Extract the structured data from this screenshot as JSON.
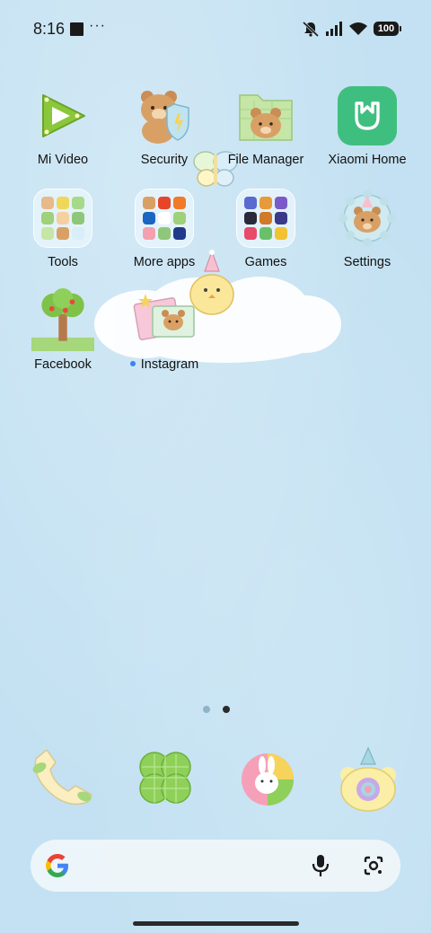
{
  "status_bar": {
    "time": "8:16",
    "overflow_indicator": "···",
    "battery": "100",
    "icons": [
      "silent-mode-icon",
      "signal-icon",
      "wifi-icon",
      "battery-icon"
    ]
  },
  "apps": [
    {
      "label": "Mi Video",
      "icon": "play-triangle-icon"
    },
    {
      "label": "Security",
      "icon": "bear-shield-icon"
    },
    {
      "label": "File Manager",
      "icon": "bear-folder-icon"
    },
    {
      "label": "Xiaomi Home",
      "icon": "xiaomi-home-icon"
    },
    {
      "label": "Tools",
      "icon": "folder-icon"
    },
    {
      "label": "More apps",
      "icon": "folder-icon"
    },
    {
      "label": "Games",
      "icon": "folder-icon"
    },
    {
      "label": "Settings",
      "icon": "bear-gear-icon"
    },
    {
      "label": "Facebook",
      "icon": "tree-icon"
    },
    {
      "label": "Instagram",
      "icon": "bear-photo-icon"
    }
  ],
  "page_indicator": {
    "current": 2,
    "total": 2
  },
  "dock": [
    {
      "icon": "phone-icon"
    },
    {
      "icon": "clover-icon"
    },
    {
      "icon": "bunny-browser-icon"
    },
    {
      "icon": "bear-camera-icon"
    }
  ],
  "search": {
    "icons": [
      "google-icon",
      "microphone-icon",
      "lens-icon"
    ]
  },
  "colors": {
    "wallpaper": "#c3e1f2",
    "xiaomi_home": "#3fbf7f",
    "notification_dot": "#3b82f6"
  }
}
